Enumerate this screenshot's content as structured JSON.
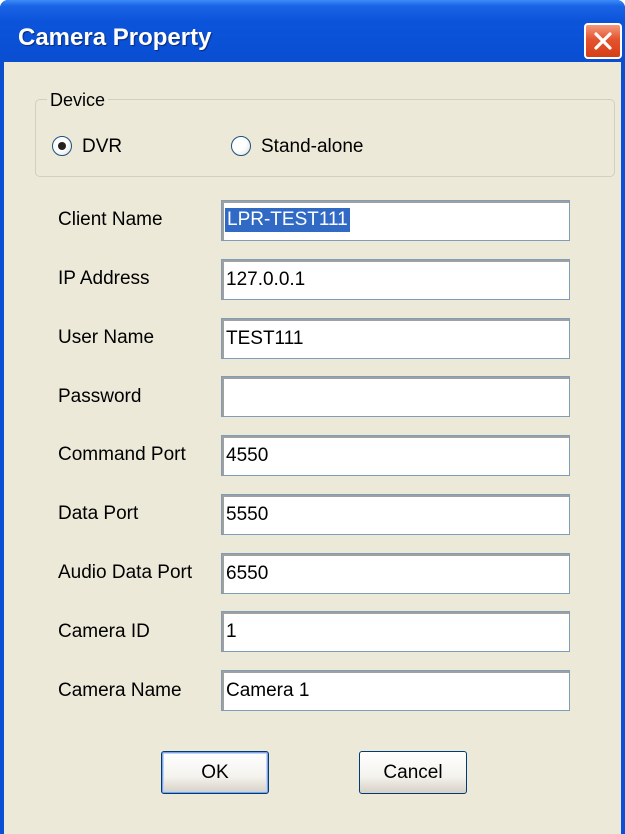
{
  "window": {
    "title": "Camera Property",
    "close_icon": "close-icon"
  },
  "device": {
    "legend": "Device",
    "options": [
      {
        "label": "DVR",
        "selected": true
      },
      {
        "label": "Stand-alone",
        "selected": false
      }
    ]
  },
  "fields": {
    "client_name": {
      "label": "Client Name",
      "value": "LPR-TEST111"
    },
    "ip_address": {
      "label": "IP Address",
      "value": "127.0.0.1"
    },
    "user_name": {
      "label": "User Name",
      "value": "TEST111"
    },
    "password": {
      "label": "Password",
      "value": ""
    },
    "command_port": {
      "label": "Command Port",
      "value": "4550"
    },
    "data_port": {
      "label": "Data Port",
      "value": "5550"
    },
    "audio_data_port": {
      "label": "Audio Data Port",
      "value": "6550"
    },
    "camera_id": {
      "label": "Camera ID",
      "value": "1"
    },
    "camera_name": {
      "label": "Camera Name",
      "value": "Camera 1"
    }
  },
  "buttons": {
    "ok": "OK",
    "cancel": "Cancel"
  },
  "colors": {
    "titlebar": "#0a4fd6",
    "face": "#ece9d8",
    "selection": "#316ac5",
    "close": "#e5532e"
  }
}
